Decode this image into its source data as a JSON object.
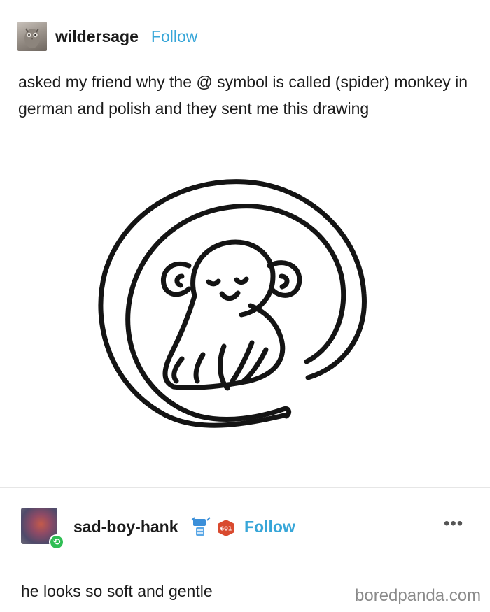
{
  "post": {
    "author": {
      "username": "wildersage",
      "follow_label": "Follow",
      "avatar_icon": "owl-avatar-icon"
    },
    "caption": "asked my friend why the @ symbol is called (spider) monkey in german and polish and they sent me this drawing",
    "image": {
      "subject": "monkey-at-symbol-drawing",
      "stroke_color": "#141414"
    }
  },
  "reblog": {
    "author": {
      "username": "sad-boy-hank",
      "follow_label": "Follow",
      "avatar_icon": "dragon-avatar-icon",
      "reblog_icon": "reblog-icon"
    },
    "badges": [
      {
        "icon": "blue-badge-icon",
        "color": "#3b8fd9"
      },
      {
        "icon": "red-badge-icon",
        "text": "601",
        "color": "#d94a2f"
      }
    ],
    "more_label": "•••",
    "text": "he looks so soft and gentle"
  },
  "watermark": "boredpanda.com",
  "colors": {
    "accent": "#37a6d8",
    "reblog_green": "#2fbe54",
    "divider": "#e6e6e6"
  }
}
